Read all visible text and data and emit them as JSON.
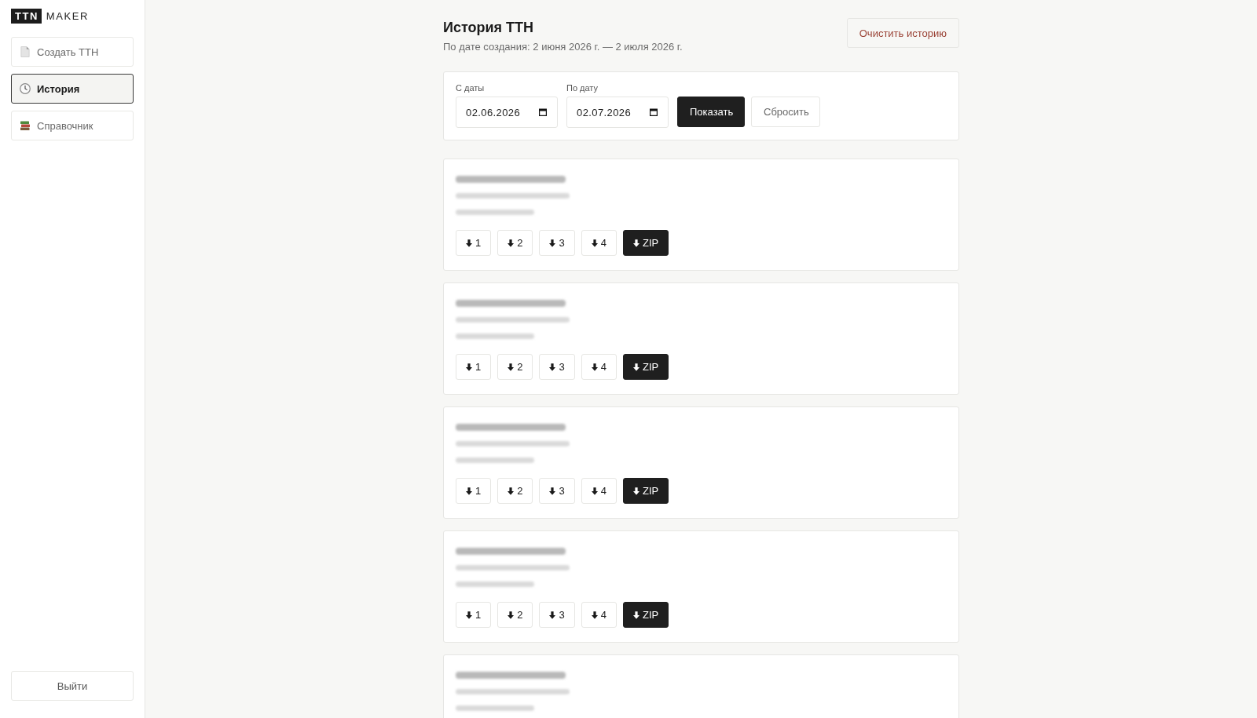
{
  "sidebar": {
    "logo": {
      "mark": "TTN",
      "text": "MAKER"
    },
    "items": [
      {
        "label": "Создать ТТН",
        "kind": "create",
        "selected": false
      },
      {
        "label": "История",
        "kind": "history",
        "selected": true
      },
      {
        "label": "Справочник",
        "kind": "directory",
        "selected": false
      }
    ],
    "logout": "Выйти"
  },
  "header": {
    "title": "История ТТН",
    "subtitle": "По дате создания: 2 июня 2026 г. — 2 июля 2026 г.",
    "clear_button": "Очистить историю"
  },
  "filter": {
    "fields": [
      {
        "label": "С даты",
        "value": "02.06.2026"
      },
      {
        "label": "По дату",
        "value": "02.07.2026"
      }
    ],
    "buttons": [
      {
        "label": "Показать",
        "kind": "primary"
      },
      {
        "label": "Сбросить",
        "kind": "secondary"
      }
    ]
  },
  "records": [
    {
      "redacted": true,
      "downloads": [
        {
          "label": "1",
          "kind": "file"
        },
        {
          "label": "2",
          "kind": "file"
        },
        {
          "label": "3",
          "kind": "file"
        },
        {
          "label": "4",
          "kind": "file"
        },
        {
          "label": "ZIP",
          "kind": "zip"
        }
      ]
    },
    {
      "redacted": true,
      "downloads": [
        {
          "label": "1",
          "kind": "file"
        },
        {
          "label": "2",
          "kind": "file"
        },
        {
          "label": "3",
          "kind": "file"
        },
        {
          "label": "4",
          "kind": "file"
        },
        {
          "label": "ZIP",
          "kind": "zip"
        }
      ]
    },
    {
      "redacted": true,
      "downloads": [
        {
          "label": "1",
          "kind": "file"
        },
        {
          "label": "2",
          "kind": "file"
        },
        {
          "label": "3",
          "kind": "file"
        },
        {
          "label": "4",
          "kind": "file"
        },
        {
          "label": "ZIP",
          "kind": "zip"
        }
      ]
    },
    {
      "redacted": true,
      "downloads": [
        {
          "label": "1",
          "kind": "file"
        },
        {
          "label": "2",
          "kind": "file"
        },
        {
          "label": "3",
          "kind": "file"
        },
        {
          "label": "4",
          "kind": "file"
        },
        {
          "label": "ZIP",
          "kind": "zip"
        }
      ]
    },
    {
      "redacted": true
    }
  ]
}
